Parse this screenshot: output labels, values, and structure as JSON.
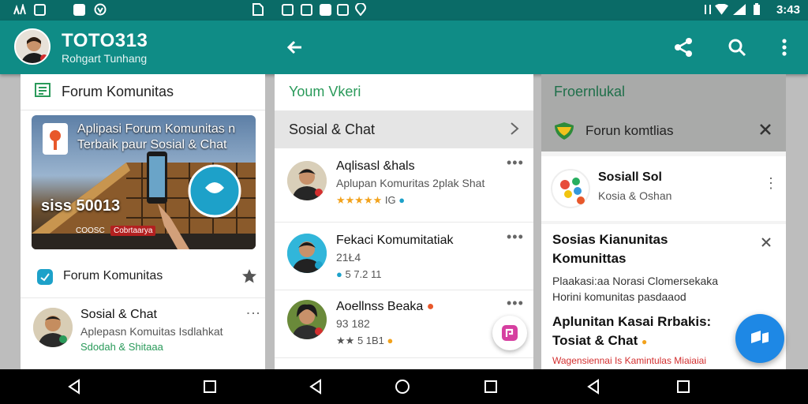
{
  "status": {
    "time": "3:43"
  },
  "toolbar": {
    "title": "TOTO313",
    "subtitle": "Rohgart Tunhang"
  },
  "panel_left": {
    "header": "Forum Komunitas",
    "hero": {
      "title_line1": "Aplipasi Forum Komunitas n",
      "title_line2": "Terbaik paur Sosial & Chat",
      "brand": "siss 50013",
      "tag1": "COOSC",
      "tag2": "Cobrtaarya"
    },
    "row2_label": "Forum Komunitas",
    "item": {
      "title": "Sosial & Chat",
      "subtitle": "Aplepasn Komuitas Isdlahkat",
      "meta": "Sdodah & Shitaaa"
    }
  },
  "panel_mid": {
    "header": "Youm Vkeri",
    "category": "Sosial & Chat",
    "items": [
      {
        "title": "Aqlisasl &hals",
        "subtitle": "Aplupan Komuritas 2plak Shat",
        "rating": "IG"
      },
      {
        "title": "Fekaci Komumitatiak",
        "subtitle": "21Ł4",
        "rating": "5 7.2   11"
      },
      {
        "title": "Aoellnss Beaka",
        "subtitle": "93 182",
        "rating": "5 1B1"
      }
    ]
  },
  "panel_right": {
    "header": "Froernlukal",
    "chip": "Forun komtlias",
    "card1": {
      "title": "Sosiall Sol",
      "subtitle": "Kosia & Oshan"
    },
    "card2": {
      "title_line1": "Sosias Kianunitas",
      "title_line2": "Komunittas",
      "body_line1": "Plaakasi:aa Norasi Clomersekaka",
      "body_line2": "Horini komunitas pasdaaod",
      "heading_line1": "Aplunitan  Kasai  Rrbakis:",
      "heading_line2": "Tosiat & Chat",
      "footer": "Wagensiennai Is Kamintulas Miaiaiai"
    }
  },
  "colors": {
    "toolbar": "#0f8c86",
    "status": "#0a6b67",
    "fab": "#1e88e5",
    "accent_green": "#2a9a5a"
  }
}
